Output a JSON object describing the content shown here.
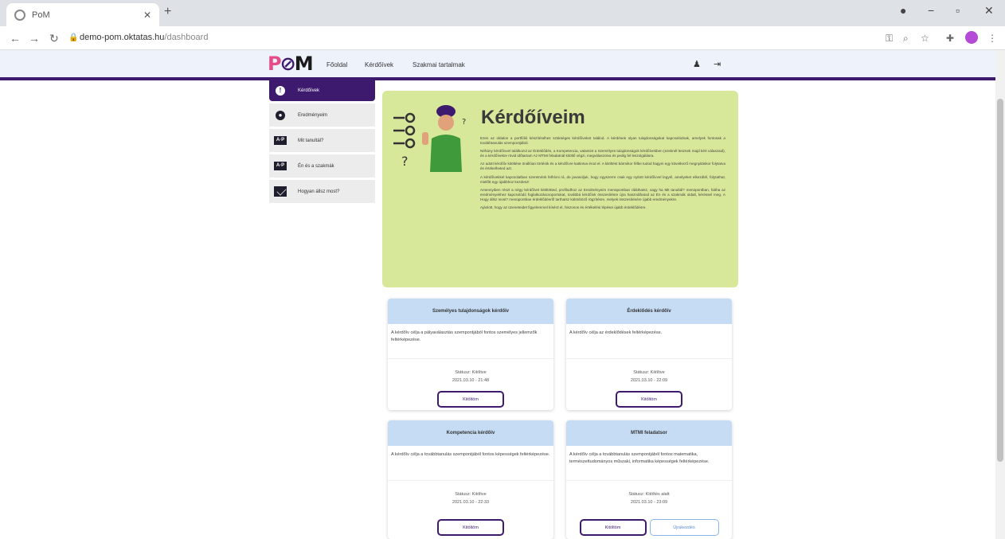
{
  "browser": {
    "tab_title": "PoM",
    "url_host": "demo-pom.oktatas.hu",
    "url_path": "/dashboard"
  },
  "app": {
    "logo": "POM",
    "nav": [
      "Főoldal",
      "Kérdőívek",
      "Szakmai tartalmak"
    ]
  },
  "sidebar": {
    "items": [
      {
        "label": "Kérdőívek",
        "icon": "info-icon"
      },
      {
        "label": "Eredményeim",
        "icon": "user-icon"
      },
      {
        "label": "Mit tanultál?",
        "icon": "learn-icon"
      },
      {
        "label": "Én és a szakmák",
        "icon": "career-icon"
      },
      {
        "label": "Hogyan állsz most?",
        "icon": "mail-icon"
      }
    ]
  },
  "intro": {
    "title": "Kérdőíveim",
    "paragraphs": [
      "Ezen az oldalon a portfólió készítéséhez szükséges kérdőíveket találod. A kérdések olyan tulajdonságokat kapcsolódnak, amelyek fontosak a továbbtanulás szempontjából.",
      "Néhány kérdőívvel találkozol az Érdeklődés, a Kompetencia, valamint a Személyes tulajdonságok kérdőívekben (ezeknél lesznek majd kért válaszaid), és a kérdőívekre rövid időtartam Az MTMI feladatnál kitöltő végzi, megválaszolva és pedig fel leszolgálásra.",
      "Az adott kérdőív kitöltése önállóan történik és a kérdőívre kattintva érod el. A kitöltést bármikor félbe tudod hagyni egy következő megnyitáskor folytatva és értékelheted azt.",
      "A kérdőívekkel kapcsolatban szeretnénk felhívni rá, de javasoljuk, hogy egyszerre csak egy nyitott kérdőívvel legyél, amelyeket elkezdtél, folytathat, mielőtt egy újabbhoz kezdesz!",
      "Amennyiben részt a négy kérdőívet kitöltötted, profilodhoz az Eredményeim menüpontban ráláthatsz, vagy ha Mit tanultál? menüpontban, hátha az eredményekhez kapcsolódó foglalkozáscsoportokat, továbbá kérdőívk összesítésre újra használhatod az Én és a szakmák oldalt, kéréssel meg. A Hogy állsz most? menüpontban érdeklődésről tarthatsz különböző rögzítésre, melyek összesítésére újabb eredményekre.",
      "Ajánlott, hogy az üzeneteidet figyelemmel kísérd el, hiszonos és értékelési lépései újabb érdeklődésre."
    ]
  },
  "cards": [
    {
      "title": "Személyes tulajdonságok kérdőív",
      "description": "A kérdőív célja a pályaválasztás szempontjából fontos személyes jellemzők feltérképezése.",
      "status_label": "Státusz: Kitöltve",
      "date": "2021.03.10 - 21:48",
      "buttons": [
        "Kitöltöm"
      ]
    },
    {
      "title": "Érdeklődés kérdőív",
      "description": "A kérdőív célja az érdeklődések feltérképezése.",
      "status_label": "Státusz: Kitöltve",
      "date": "2021.03.10 - 22:09",
      "buttons": [
        "Kitöltöm"
      ]
    },
    {
      "title": "Kompetencia kérdőív",
      "description": "A kérdőív célja a továbbtanulás szempontjából fontos képességek feltérképezése.",
      "status_label": "Státusz: Kitöltve",
      "date": "2021.03.10 - 22:33",
      "buttons": [
        "Kitöltöm"
      ]
    },
    {
      "title": "MTMI feladatsor",
      "description": "A kérdőív célja a továbbtanulás szempontjából fontos matematika, természettudományos műszaki, informatika képességek feltérképezése.",
      "status_label": "Státusz: Kitöltés alatt",
      "date": "2021.03.10 - 23:09",
      "buttons": [
        "Kitöltöm",
        "Újrakezdés"
      ]
    }
  ],
  "colors": {
    "accent": "#3d1a6e",
    "intro_bg": "#d8e89a",
    "card_head": "#c6dcf5",
    "logo_pink": "#e44d8a"
  }
}
